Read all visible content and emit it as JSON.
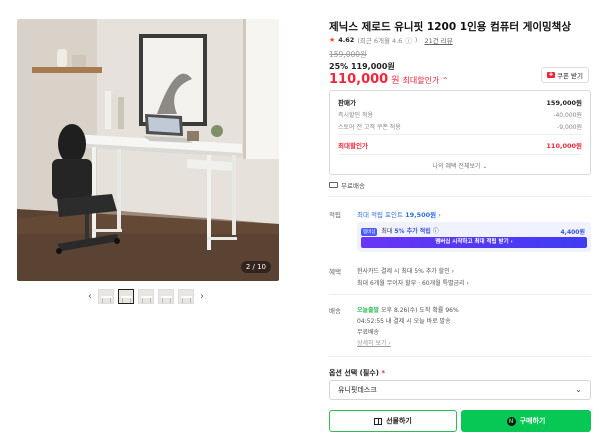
{
  "gallery": {
    "counter": "2 / 10",
    "prev": "‹",
    "next": "›",
    "thumb_count": 5
  },
  "product": {
    "title": "제닉스 제로드 유니핏 1200 1인용 컴퓨터 게이밍책상",
    "rating": "4.62",
    "rating_note": "(최근 6개월 4.6",
    "rating_note_end": ")",
    "review_link": "21건 리뷰",
    "original_price": "159,000원",
    "discount_percent": "25%",
    "discount_price": "119,000원",
    "max_discount_price": "110,000",
    "max_unit": "원",
    "max_label": "최대할인가 ⌃",
    "coupon_label": "쿠폰 받기"
  },
  "price_box": {
    "rows": [
      {
        "label": "판매가",
        "value": "159,000원"
      },
      {
        "label": "즉시할인 적용",
        "value": "-40,000원"
      },
      {
        "label": "스토어 전 고객 쿠폰 적용",
        "value": "-9,000원"
      },
      {
        "label": "최대할인가",
        "value": "110,000원"
      }
    ],
    "more_label": "나의 혜택 전체보기 ⌄"
  },
  "delivery": {
    "free_label": "무료배송"
  },
  "points": {
    "label": "적립",
    "top_text": "최대 적립 포인트",
    "top_count": "19,500원",
    "top_chev": "›",
    "badge": "멤버십",
    "line_prefix": "최대",
    "line_pct": "5% 추가 적립",
    "line_q": "ⓘ",
    "line_value": "4,400원",
    "membership_btn": "멤버십 시작하고 최대 적립 받기 ›"
  },
  "benefit": {
    "label": "혜택",
    "line1": "현사카드 결제 시 최대 5% 추가 할인 ›",
    "line2": "최대 6개월 무이자 할부 · 60개월 특별금리 ›"
  },
  "shipping": {
    "label": "배송",
    "today": "오늘출발",
    "line1": "오후 8.26(수) 도착 확률 96%",
    "line2": "04:52:55  내 결제 시 오늘 바로 발송",
    "line3": "무료배송",
    "line4": "일반택배",
    "detail_link": "상세히 보기 ›"
  },
  "option": {
    "label": "옵션 선택 (필수)",
    "required_mark": "*",
    "selected": "유니핏데스크",
    "chevron": "⌄"
  },
  "actions": {
    "gift": "선물하기",
    "buy": "구매하기",
    "npay": "N"
  },
  "colors": {
    "accent_red": "#f0263c",
    "naver_green": "#07c755",
    "points_blue": "#2f6ee6",
    "membership_purple": "#6a35f5"
  }
}
